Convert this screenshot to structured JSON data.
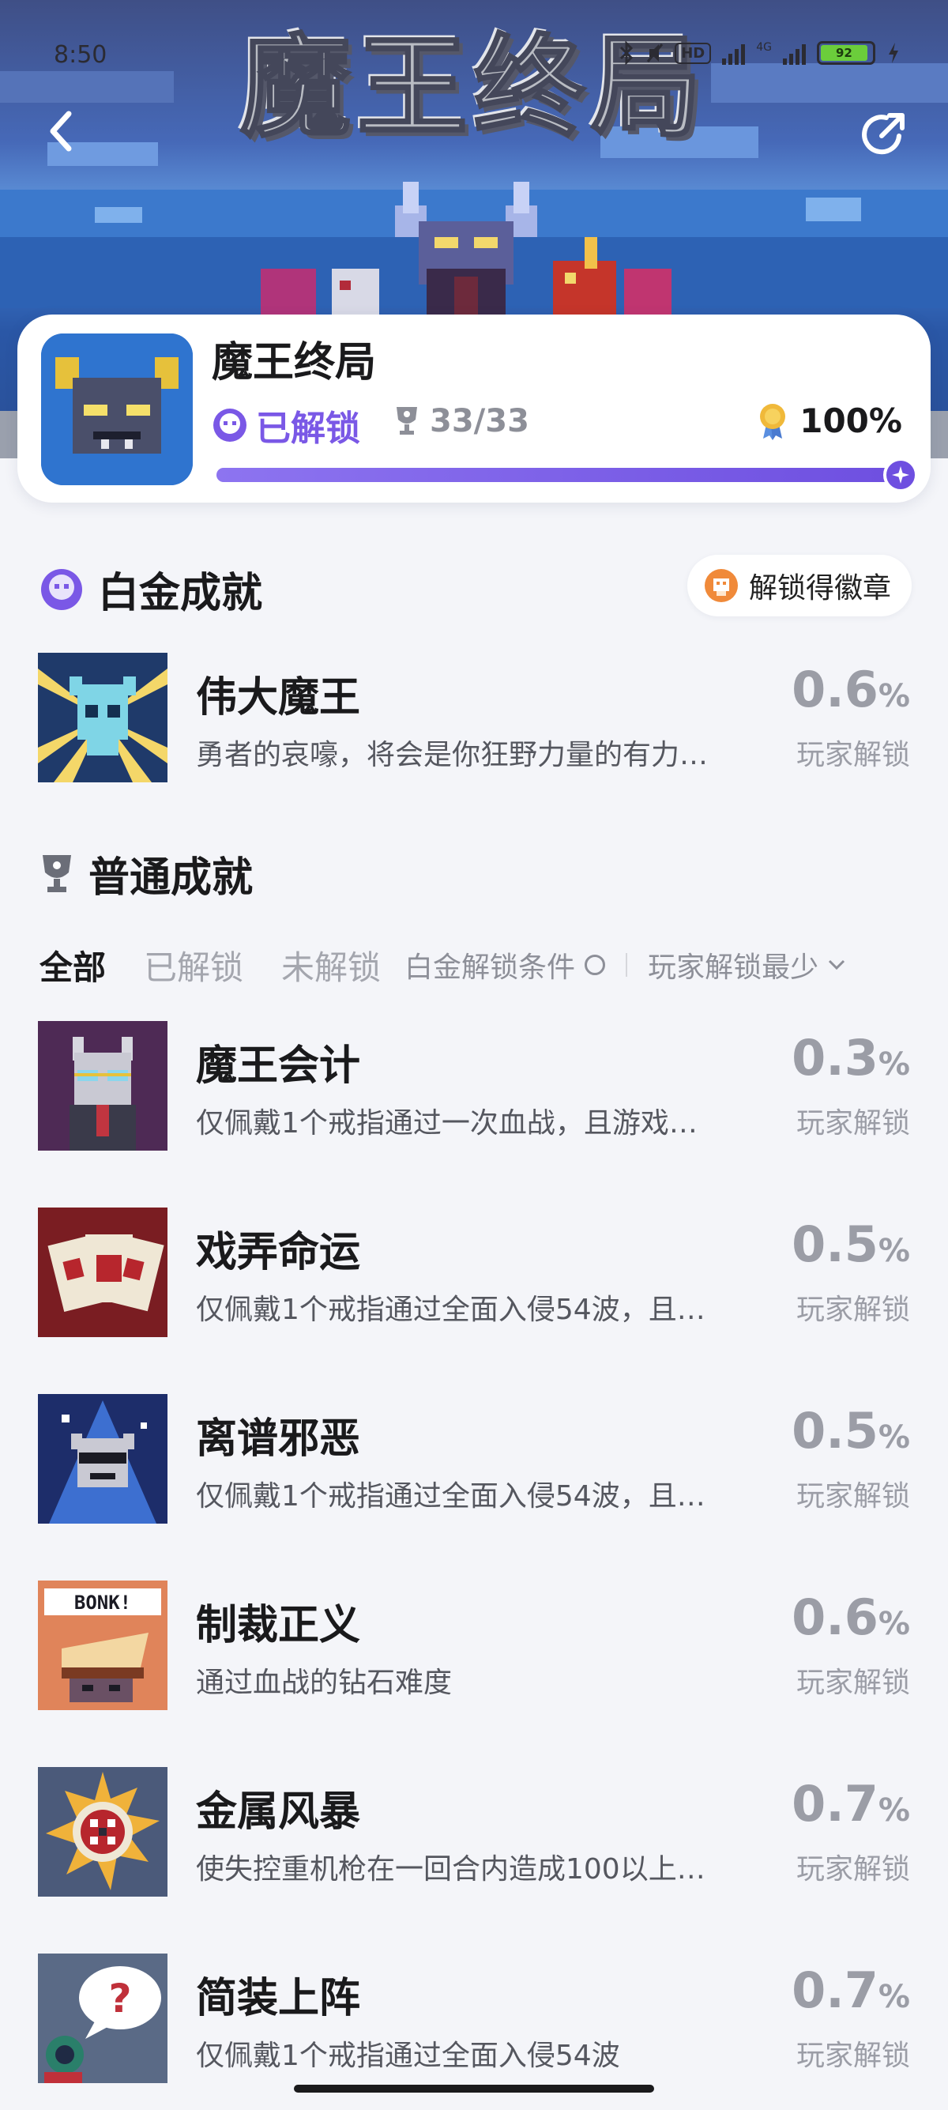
{
  "status_bar": {
    "time": "8:50",
    "hd": "HD",
    "network": "4G",
    "battery": "92"
  },
  "banner": {
    "title_art": "魔王终局"
  },
  "game": {
    "name": "魔王终局",
    "unlock_status": "已解锁",
    "trophy_count": "33/33",
    "completion": "100%",
    "progress": 1.0
  },
  "platinum": {
    "section_title": "白金成就",
    "badge_button": "解锁得徽章",
    "achievement": {
      "name": "伟大魔王",
      "desc": "勇者的哀嚎，将会是你狂野力量的有力…",
      "pct": "0.6",
      "unit": "%",
      "sub": "玩家解锁"
    }
  },
  "normal": {
    "section_title": "普通成就",
    "filters": {
      "all": "全部",
      "unlocked": "已解锁",
      "locked": "未解锁",
      "condition": "白金解锁条件",
      "sort": "玩家解锁最少"
    },
    "achievements": [
      {
        "name": "魔王会计",
        "desc": "仅佩戴1个戒指通过一次血战，且游戏…",
        "pct": "0.3",
        "unit": "%",
        "sub": "玩家解锁"
      },
      {
        "name": "戏弄命运",
        "desc": "仅佩戴1个戒指通过全面入侵54波，且…",
        "pct": "0.5",
        "unit": "%",
        "sub": "玩家解锁"
      },
      {
        "name": "离谱邪恶",
        "desc": "仅佩戴1个戒指通过全面入侵54波，且…",
        "pct": "0.5",
        "unit": "%",
        "sub": "玩家解锁"
      },
      {
        "name": "制裁正义",
        "desc": "通过血战的钻石难度",
        "pct": "0.6",
        "unit": "%",
        "sub": "玩家解锁",
        "icon_text": "BONK!"
      },
      {
        "name": "金属风暴",
        "desc": "使失控重机枪在一回合内造成100以上…",
        "pct": "0.7",
        "unit": "%",
        "sub": "玩家解锁"
      },
      {
        "name": "简装上阵",
        "desc": "仅佩戴1个戒指通过全面入侵54波",
        "pct": "0.7",
        "unit": "%",
        "sub": "玩家解锁",
        "icon_text": "?"
      }
    ]
  },
  "colors": {
    "accent": "#7a58e6",
    "progress": "#6e4fe0",
    "background": "#f4f5f9",
    "muted": "#9b9da6"
  }
}
